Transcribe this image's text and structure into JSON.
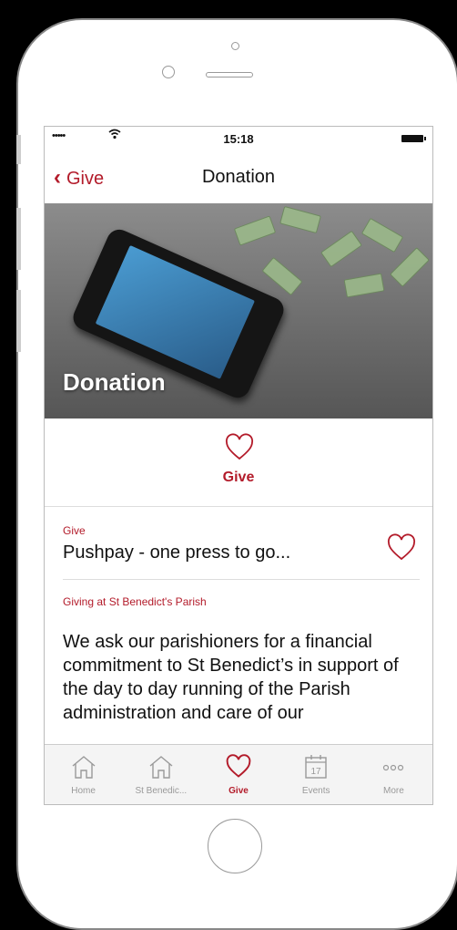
{
  "status_bar": {
    "signal": "•••••",
    "time": "15:18"
  },
  "navbar": {
    "back_label": "Give",
    "title": "Donation"
  },
  "hero": {
    "title": "Donation"
  },
  "give_action": {
    "label": "Give"
  },
  "list": {
    "items": [
      {
        "caption": "Give",
        "title": "Pushpay - one press to go..."
      }
    ]
  },
  "section": {
    "caption": "Giving at St Benedict's Parish",
    "body": "We ask our parishioners for a financial commitment to St Benedict’s in support of the day to day running of the Parish administration and care of our"
  },
  "tabs": [
    {
      "label": "Home",
      "icon": "home-icon"
    },
    {
      "label": "St Benedic...",
      "icon": "home-icon"
    },
    {
      "label": "Give",
      "icon": "heart-icon",
      "active": true
    },
    {
      "label": "Events",
      "icon": "calendar-icon",
      "date": "17"
    },
    {
      "label": "More",
      "icon": "more-icon"
    }
  ],
  "colors": {
    "accent": "#b31b2a"
  }
}
